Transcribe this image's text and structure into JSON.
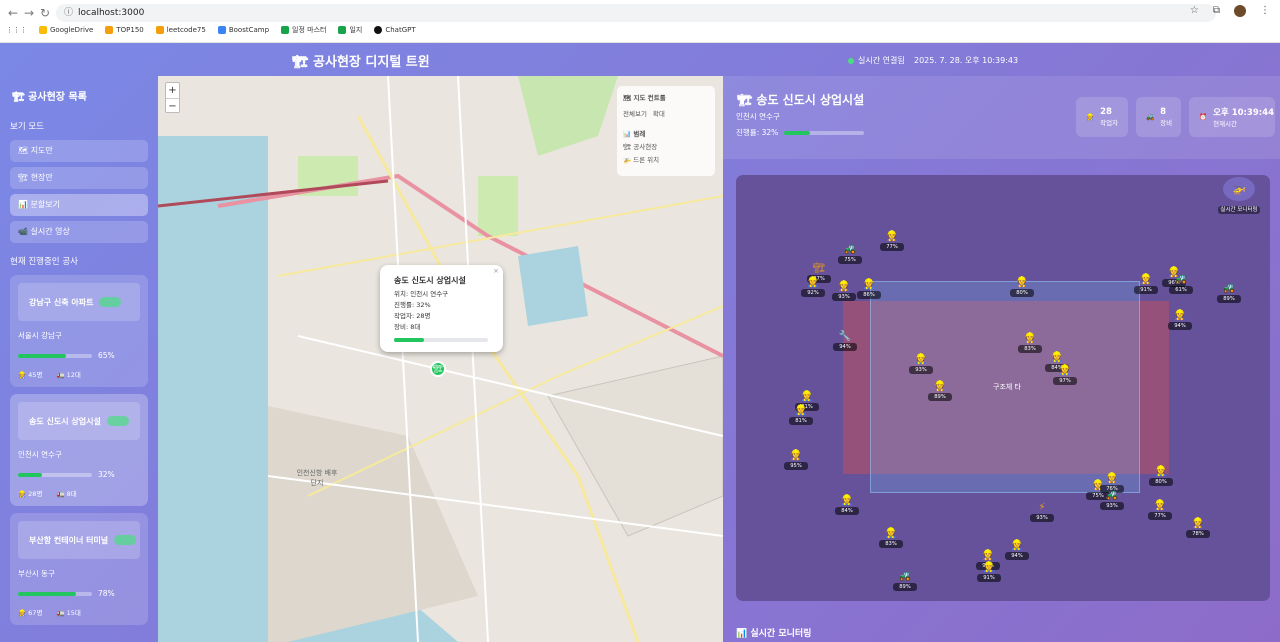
{
  "browser": {
    "url": "localhost:3000",
    "bookmarks": [
      {
        "label": "GoogleDrive",
        "color": "#fbbc04"
      },
      {
        "label": "TOP150",
        "color": "#f59e0b"
      },
      {
        "label": "leetcode75",
        "color": "#f59e0b"
      },
      {
        "label": "BoostCamp",
        "color": "#3b82f6"
      },
      {
        "label": "일정 마스터",
        "color": "#16a34a"
      },
      {
        "label": "일지",
        "color": "#16a34a"
      },
      {
        "label": "ChatGPT",
        "color": "#111111"
      }
    ]
  },
  "header": {
    "title": "🏗 공사현장 디지털 트윈",
    "connection": "실시간 연결됨",
    "datetime": "2025. 7. 28. 오후 10:39:43"
  },
  "sidebar": {
    "title": "🏗 공사현장 목록",
    "view_mode_label": "보기 모드",
    "modes": [
      {
        "label": "🗺 지도만",
        "active": false
      },
      {
        "label": "🏗 현장만",
        "active": false
      },
      {
        "label": "📊 분할보기",
        "active": true
      },
      {
        "label": "📹 실시간 영상",
        "active": false
      }
    ],
    "projects_label": "현재 진행중인 공사",
    "projects": [
      {
        "name": "강남구 신축 아파트",
        "location": "서울시 강남구",
        "progress": 65,
        "progress_label": "65%",
        "workers": "45명",
        "equipment": "12대",
        "active": false
      },
      {
        "name": "송도 신도시 상업시설",
        "location": "인천시 연수구",
        "progress": 32,
        "progress_label": "32%",
        "workers": "28명",
        "equipment": "8대",
        "active": true
      },
      {
        "name": "부산항 컨테이너 터미널",
        "location": "부산시 동구",
        "progress": 78,
        "progress_label": "78%",
        "workers": "67명",
        "equipment": "15대",
        "active": false
      }
    ]
  },
  "map": {
    "zoom_in": "+",
    "zoom_out": "−",
    "controls_title": "🗺 지도 컨트롤",
    "control_btn_1": "전체보기",
    "control_btn_2": "확대",
    "legend_title": "📊 범례",
    "legend_1": "🏗 공사현장",
    "legend_2": "🚁 드론 위치",
    "label_port": "인천신항 배후단지",
    "popup": {
      "title": "송도 신도시 상업시설",
      "location": "위치: 인천시 연수구",
      "progress": "진행률: 32%",
      "workers": "작업자: 28명",
      "equipment": "장비: 8대",
      "progress_value": 32,
      "close": "×"
    }
  },
  "site": {
    "title": "🏗 송도 신도시 상업시설",
    "location": "인천시 연수구",
    "progress_label": "진행률: 32%",
    "progress_value": 32,
    "stat_workers": {
      "value": "28",
      "label": "작업자"
    },
    "stat_equipment": {
      "value": "8",
      "label": "장비"
    },
    "stat_time": {
      "value": "오후 10:39:44",
      "label": "현재시간"
    },
    "realtime_monitoring": "실시간 모니터링",
    "zone_label": "구조체 타",
    "bottom_title": "📊 실시간 모니터링",
    "workers": [
      {
        "v": "77%",
        "g": "👷"
      },
      {
        "v": "75%",
        "g": "🚜"
      },
      {
        "v": "87%",
        "g": "🏗"
      },
      {
        "v": "92%",
        "g": "👷"
      },
      {
        "v": "93%",
        "g": "👷"
      },
      {
        "v": "86%",
        "g": "👷"
      },
      {
        "v": "80%",
        "g": "👷"
      },
      {
        "v": "91%",
        "g": "👷"
      },
      {
        "v": "96%",
        "g": "👷"
      },
      {
        "v": "61%",
        "g": "🚜"
      },
      {
        "v": "89%",
        "g": "🚜"
      },
      {
        "v": "94%",
        "g": "👷"
      },
      {
        "v": "94%",
        "g": "🔧"
      },
      {
        "v": "83%",
        "g": "👷"
      },
      {
        "v": "93%",
        "g": "👷"
      },
      {
        "v": "84%",
        "g": "👷"
      },
      {
        "v": "97%",
        "g": "👷"
      },
      {
        "v": "81%",
        "g": "👷"
      },
      {
        "v": "89%",
        "g": "👷"
      },
      {
        "v": "81%",
        "g": "👷"
      },
      {
        "v": "95%",
        "g": "👷"
      },
      {
        "v": "80%",
        "g": "👷"
      },
      {
        "v": "75%",
        "g": "👷"
      },
      {
        "v": "76%",
        "g": "👷"
      },
      {
        "v": "93%",
        "g": "🚜"
      },
      {
        "v": "84%",
        "g": "👷"
      },
      {
        "v": "93%",
        "g": "⚡"
      },
      {
        "v": "77%",
        "g": "👷"
      },
      {
        "v": "78%",
        "g": "👷"
      },
      {
        "v": "83%",
        "g": "👷"
      },
      {
        "v": "94%",
        "g": "👷"
      },
      {
        "v": "91%",
        "g": "👷"
      },
      {
        "v": "91%",
        "g": "👷"
      },
      {
        "v": "89%",
        "g": "🚜"
      }
    ]
  }
}
